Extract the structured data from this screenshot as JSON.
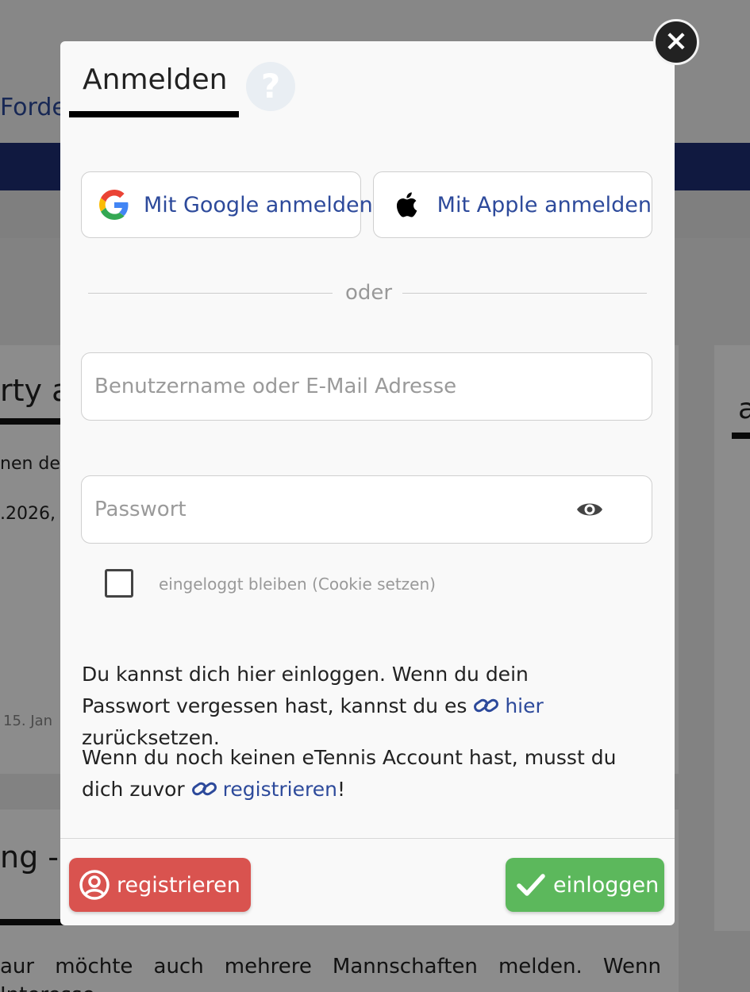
{
  "background": {
    "nav_link": "Forde",
    "card_a_heading": "rty a",
    "card_a_line1": "nen de",
    "card_a_line2": ".2026,",
    "card_a_date": "15. Jan",
    "card_b_heading": "a",
    "card_c_heading": "ng -",
    "card_c_paragraph": "aur möchte auch mehrere Mannschaften melden. Wenn Interesse"
  },
  "modal": {
    "tab_title": "Anmelden",
    "help_icon_glyph": "?",
    "close_glyph": "×",
    "social": {
      "google_label": "Mit Google anmelden",
      "apple_label": "Mit Apple anmelden"
    },
    "divider_text": "oder",
    "username": {
      "placeholder": "Benutzername oder E-Mail Adresse",
      "value": ""
    },
    "password": {
      "placeholder": "Passwort",
      "value": ""
    },
    "remember_label": "eingeloggt bleiben (Cookie setzen)",
    "info1": {
      "before": "Du kannst dich hier einloggen. Wenn du dein Passwort vergessen hast, kannst du es ",
      "link": "hier",
      "after": " zurücksetzen."
    },
    "info2": {
      "before": "Wenn du noch keinen eTennis Account hast, musst du dich zuvor ",
      "link": "registrieren",
      "after": "!"
    },
    "buttons": {
      "register_label": "registrieren",
      "login_label": "einloggen"
    }
  },
  "colors": {
    "link": "#2d4a9b",
    "danger": "#d9534f",
    "success": "#5cb85c",
    "navy_band": "#1e2f75"
  }
}
